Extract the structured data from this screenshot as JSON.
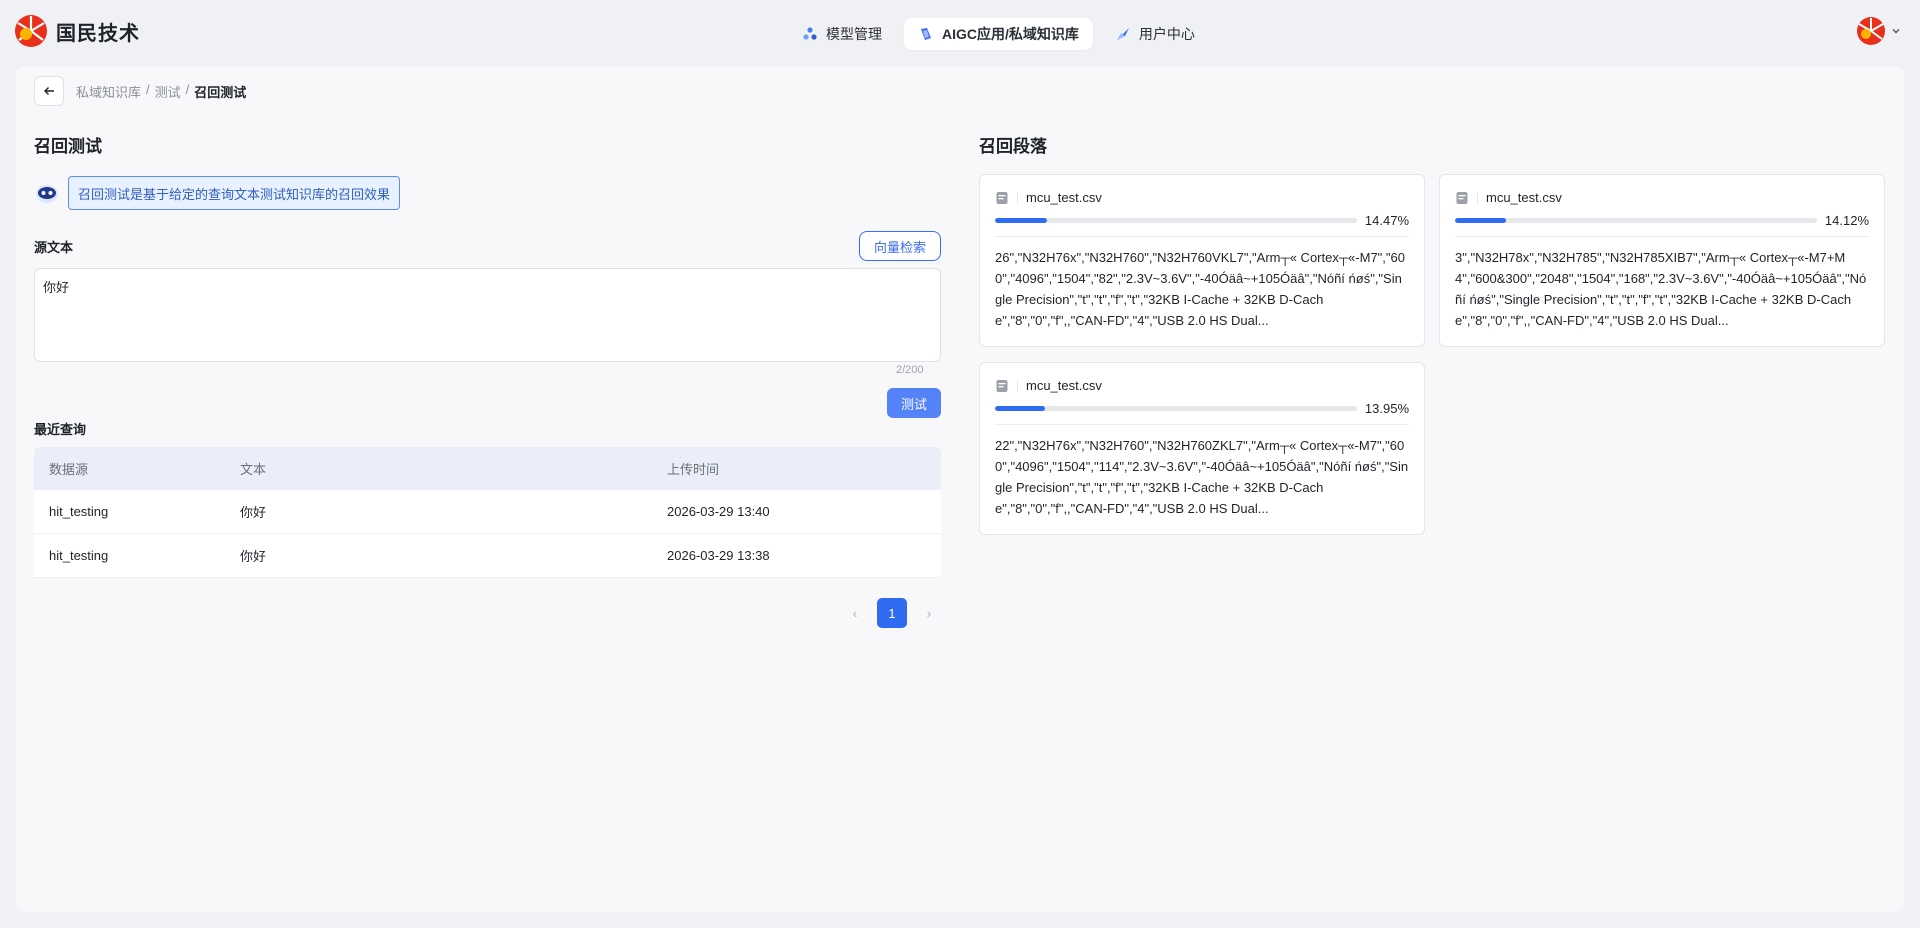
{
  "app": {
    "brand_name": "国民技术"
  },
  "nav": {
    "items": [
      {
        "label": "模型管理",
        "icon": "models-icon",
        "active": false
      },
      {
        "label": "AIGC应用/私域知识库",
        "icon": "knowledge-icon",
        "active": true
      },
      {
        "label": "用户中心",
        "icon": "user-center-icon",
        "active": false
      }
    ]
  },
  "breadcrumb": {
    "items": [
      "私域知识库",
      "测试"
    ],
    "sep": "/",
    "current": "召回测试"
  },
  "left": {
    "title": "召回测试",
    "tip": "召回测试是基于给定的查询文本测试知识库的召回效果",
    "source_label": "源文本",
    "vector_button": "向量检索",
    "source_value": "你好",
    "counter": "2/200",
    "test_button": "测试",
    "recent_title": "最近查询",
    "table": {
      "headers": [
        "数据源",
        "文本",
        "上传时间"
      ],
      "rows": [
        {
          "source": "hit_testing",
          "text": "你好",
          "time": "2026-03-29 13:40"
        },
        {
          "source": "hit_testing",
          "text": "你好",
          "time": "2026-03-29 13:38"
        }
      ]
    },
    "pagination": {
      "current": "1"
    }
  },
  "right": {
    "title": "召回段落",
    "cards": [
      {
        "file": "mcu_test.csv",
        "score": "14.47%",
        "score_value": 0.1447,
        "text": "26\",\"N32H76x\",\"N32H760\",\"N32H760VKL7\",\"Arm┬« Cortex┬«-M7\",\"600\",\"4096\",\"1504\",\"82\",\"2.3V~3.6V\",\"-40Óäâ~+105Óäâ\",\"Nóñí ńøś\",\"Single Precision\",\"t\",\"t\",\"f\",\"t\",\"32KB I-Cache + 32KB D-Cache\",\"8\",\"0\",\"f\",,\"CAN-FD\",\"4\",\"USB 2.0 HS Dual..."
      },
      {
        "file": "mcu_test.csv",
        "score": "14.12%",
        "score_value": 0.1412,
        "text": "3\",\"N32H78x\",\"N32H785\",\"N32H785XIB7\",\"Arm┬« Cortex┬«-M7+M4\",\"600&300\",\"2048\",\"1504\",\"168\",\"2.3V~3.6V\",\"-40Óäâ~+105Óäâ\",\"Nóñí ńøś\",\"Single Precision\",\"t\",\"t\",\"f\",\"t\",\"32KB I-Cache + 32KB D-Cache\",\"8\",\"0\",\"f\",,\"CAN-FD\",\"4\",\"USB 2.0 HS Dual..."
      },
      {
        "file": "mcu_test.csv",
        "score": "13.95%",
        "score_value": 0.1395,
        "text": "22\",\"N32H76x\",\"N32H760\",\"N32H760ZKL7\",\"Arm┬« Cortex┬«-M7\",\"600\",\"4096\",\"1504\",\"114\",\"2.3V~3.6V\",\"-40Óäâ~+105Óäâ\",\"Nóñí ńøś\",\"Single Precision\",\"t\",\"t\",\"f\",\"t\",\"32KB I-Cache + 32KB D-Cache\",\"8\",\"0\",\"f\",,\"CAN-FD\",\"4\",\"USB 2.0 HS Dual..."
      }
    ]
  },
  "colors": {
    "accent": "#2f6bf0",
    "tip_bg": "#e8f1ff",
    "brand_red": "#e8301c",
    "brand_yellow": "#f7b500"
  }
}
